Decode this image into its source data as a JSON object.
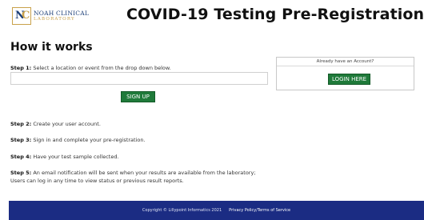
{
  "header": {
    "logo_line1": "NOAH CLINICAL",
    "logo_line2": "LABORATORY",
    "title": "COVID-19 Testing Pre-Registration"
  },
  "main": {
    "section_title": "How it works",
    "steps": [
      {
        "label": "Step 1:",
        "text": "Select a location or event from the drop down below."
      },
      {
        "label": "Step 2:",
        "text": "Create your user account."
      },
      {
        "label": "Step 3:",
        "text": "Sign in and complete your pre-registration."
      },
      {
        "label": "Step 4:",
        "text": "Have your test sample collected."
      },
      {
        "label": "Step 5:",
        "text": "An email notification will be sent when your results are available from the laboratory;",
        "text2": "Users can log in any time to view status or previous result reports."
      }
    ],
    "location_select": {
      "value": ""
    },
    "signup_label": "SIGN UP"
  },
  "account_box": {
    "heading": "Already have an Account?",
    "login_label": "LOGIN HERE"
  },
  "footer": {
    "copyright": "Copyright © Lillypoint Informatics 2021",
    "privacy_link": "Privacy Policy/Terms of Service"
  },
  "colors": {
    "button_green": "#1f7a3a",
    "footer_blue": "#1b2c83",
    "logo_gold": "#c9a14a",
    "logo_navy": "#1c3f78"
  }
}
